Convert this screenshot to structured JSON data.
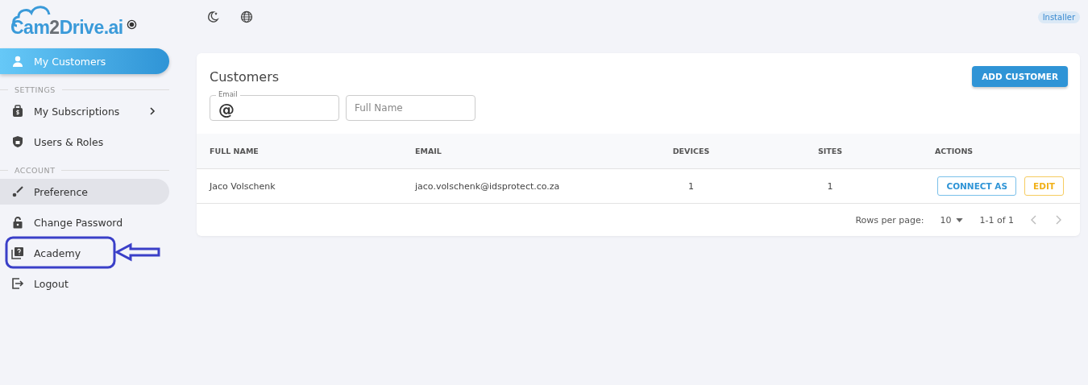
{
  "logo": {
    "parts": [
      "Cam",
      "2",
      "Drive.ai"
    ]
  },
  "sidebar": {
    "items": [
      {
        "label": "My Customers",
        "selected": true,
        "hovered": false,
        "submenu": false,
        "annotated": false
      }
    ],
    "sections": [
      {
        "title": "SETTINGS",
        "items": [
          {
            "label": "My Subscriptions",
            "selected": false,
            "hovered": false,
            "submenu": true,
            "annotated": false
          },
          {
            "label": "Users & Roles",
            "selected": false,
            "hovered": false,
            "submenu": false,
            "annotated": false
          }
        ]
      },
      {
        "title": "ACCOUNT",
        "items": [
          {
            "label": "Preference",
            "selected": false,
            "hovered": true,
            "submenu": false,
            "annotated": false
          },
          {
            "label": "Change Password",
            "selected": false,
            "hovered": false,
            "submenu": false,
            "annotated": false
          },
          {
            "label": "Academy",
            "selected": false,
            "hovered": false,
            "submenu": false,
            "annotated": true
          },
          {
            "label": "Logout",
            "selected": false,
            "hovered": false,
            "submenu": false,
            "annotated": false
          }
        ]
      }
    ]
  },
  "role_badge": "Installer",
  "card": {
    "title": "Customers",
    "add_button": "ADD CUSTOMER",
    "filters": [
      {
        "label": "Email",
        "value": "@"
      },
      {
        "placeholder": "Full Name"
      }
    ],
    "table": {
      "columns": [
        "FULL NAME",
        "EMAIL",
        "DEVICES",
        "SITES",
        "ACTIONS"
      ],
      "rows": [
        {
          "cells": [
            "Jaco Volschenk",
            "jaco.volschenk@idsprotect.co.za",
            "1",
            "1"
          ],
          "actions": [
            {
              "label": "CONNECT AS",
              "kind": "primary"
            },
            {
              "label": "EDIT",
              "kind": "warning"
            }
          ]
        }
      ]
    },
    "footer": {
      "rows_per_page_label": "Rows per page:",
      "rows_per_page": "10",
      "range": "1-1 of 1"
    }
  }
}
